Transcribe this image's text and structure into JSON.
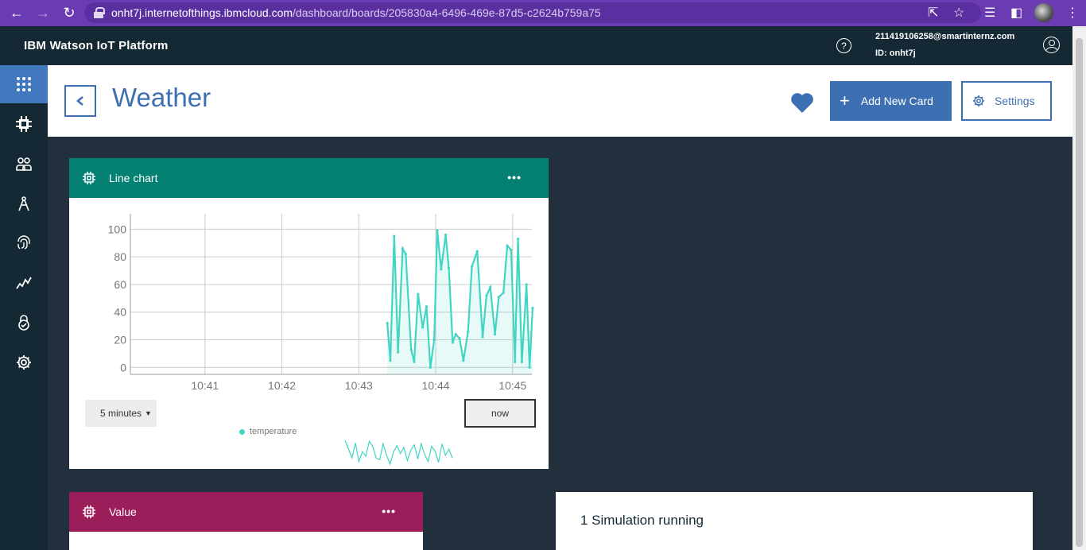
{
  "browser": {
    "url_host": "onht7j.internetofthings.ibmcloud.com",
    "url_path": "/dashboard/boards/205830a4-6496-469e-87d5-c2624b759a75"
  },
  "header": {
    "app_title": "IBM Watson IoT Platform",
    "user_email": "211419106258@smartinternz.com",
    "user_id": "ID: onht7j",
    "help_label": "?"
  },
  "sidebar": {
    "items": [
      {
        "icon": "apps-grid-icon"
      },
      {
        "icon": "chip-icon"
      },
      {
        "icon": "members-icon"
      },
      {
        "icon": "rules-icon"
      },
      {
        "icon": "fingerprint-icon"
      },
      {
        "icon": "analytics-icon"
      },
      {
        "icon": "security-icon"
      },
      {
        "icon": "settings-icon"
      }
    ]
  },
  "page": {
    "title": "Weather",
    "add_card_label": "Add New Card",
    "settings_label": "Settings"
  },
  "cards": {
    "line_chart": {
      "title": "Line chart",
      "menu": "•••",
      "time_range": "5 minutes",
      "now_label": "now",
      "legend": "temperature",
      "color": "#058173"
    },
    "value": {
      "title": "Value",
      "menu": "•••",
      "color": "#9b1e5a"
    }
  },
  "simulation": {
    "text": "1 Simulation running"
  },
  "chart_data": {
    "type": "line",
    "title": "Line chart",
    "xlabel": "",
    "ylabel": "",
    "x_ticks": [
      "10:41",
      "10:42",
      "10:43",
      "10:44",
      "10:45"
    ],
    "y_ticks": [
      0,
      20,
      40,
      60,
      80,
      100
    ],
    "ylim": [
      -5,
      110
    ],
    "series": [
      {
        "name": "temperature",
        "color": "#41d6c3",
        "x": [
          43.37,
          43.41,
          43.46,
          43.51,
          43.57,
          43.61,
          43.68,
          43.72,
          43.77,
          43.83,
          43.88,
          43.93,
          43.98,
          44.02,
          44.07,
          44.13,
          44.17,
          44.22,
          44.26,
          44.31,
          44.36,
          44.42,
          44.47,
          44.54,
          44.61,
          44.66,
          44.71,
          44.77,
          44.82,
          44.88,
          44.93,
          44.98,
          45.03,
          45.07,
          45.12,
          45.18,
          45.22,
          45.26
        ],
        "y": [
          32,
          5,
          95,
          11,
          86,
          82,
          13,
          4,
          53,
          29,
          44,
          0,
          20,
          99,
          71,
          96,
          72,
          18,
          24,
          21,
          5,
          26,
          73,
          84,
          22,
          52,
          58,
          24,
          51,
          54,
          88,
          85,
          4,
          93,
          4,
          60,
          0,
          43
        ]
      }
    ],
    "sparkline": [
      34,
      24,
      14,
      31,
      10,
      21,
      16,
      33,
      27,
      14,
      12,
      30,
      17,
      7,
      21,
      28,
      19,
      26,
      11,
      23,
      29,
      13,
      30,
      18,
      10,
      27,
      22,
      9,
      30,
      17,
      24,
      14
    ],
    "grid": true,
    "legend_position": "bottom"
  }
}
